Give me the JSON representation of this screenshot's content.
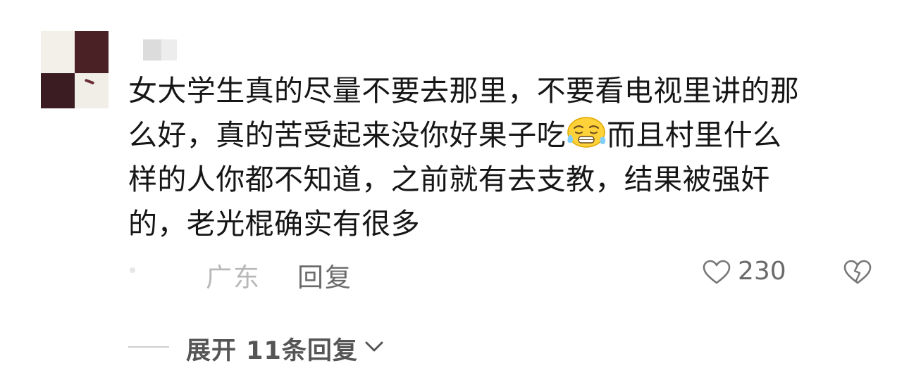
{
  "comment": {
    "lines": [
      "女大学生真的尽量不要去那里，不要看电视里讲的那",
      "么好，真的苦受起来没你好果子吃",
      "而且村里什么",
      "样的人你都不知道，之前就有去支教，结果被强奸",
      "的，老光棍确实有很多"
    ],
    "emoji": "anxious-sweat-emoji"
  },
  "meta": {
    "location": "广东",
    "reply_label": "回复",
    "like_count": "230"
  },
  "expand": {
    "label": "展开 11条回复"
  },
  "icons": {
    "like": "heart-icon",
    "dislike": "broken-heart-icon",
    "chevron": "chevron-down-icon"
  },
  "colors": {
    "text": "#161616",
    "secondary": "#6b6b6b",
    "muted": "#b8b8b8"
  }
}
